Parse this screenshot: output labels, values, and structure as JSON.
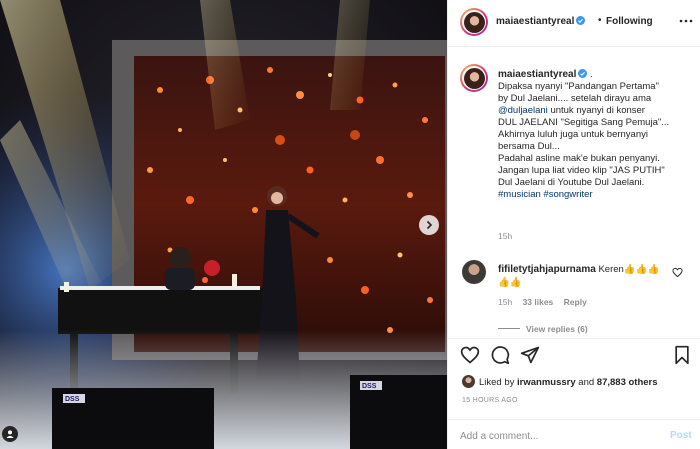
{
  "post": {
    "username": "maiaestiantyreal",
    "follow_status": "Following",
    "separator": "•",
    "caption_dot": ".",
    "caption_lines": [
      "Dipaksa nyanyi \"Pandangan Pertama\"",
      "by Dul Jaelani.... setelah dirayu ama",
      "untuk nyanyi di konser",
      "DUL JAELANI \"Segitiga Sang Pemuja\"...",
      "Akhirnya luluh juga untuk bernyanyi",
      "bersama Dul...",
      "Padahal asline mak'e bukan penyanyi.",
      "Jangan lupa liat video klip \"JAS PUTIH\"",
      "Dul Jaelani di Youtube Dul Jaelani."
    ],
    "mention": "@duljaelani",
    "hashtags": [
      "#musician",
      "#songwriter"
    ],
    "caption_time": "15h"
  },
  "comment": {
    "username": "fifiletytjahjapurnama",
    "text": "Keren👍👍👍👍👍",
    "time": "15h",
    "likes": "33 likes",
    "reply_label": "Reply",
    "view_replies": "View replies (6)"
  },
  "likes": {
    "prefix": "Liked by",
    "user": "irwanmussry",
    "joiner": "and",
    "others": "87,883 others"
  },
  "timestamp": "15 HOURS AGO",
  "add_comment": {
    "placeholder": "Add a comment...",
    "post_label": "Post"
  },
  "media": {
    "speaker_brand": "DSS"
  },
  "colors": {
    "link": "#00376b",
    "verified": "#3897f0",
    "post_disabled": "#b3dbff",
    "border": "#efefef",
    "muted": "#8e8e8e"
  },
  "icons": [
    "more-options-icon",
    "verified-badge-icon",
    "heart-icon",
    "comment-icon",
    "share-icon",
    "bookmark-icon",
    "next-arrow-icon",
    "tag-user-icon"
  ]
}
